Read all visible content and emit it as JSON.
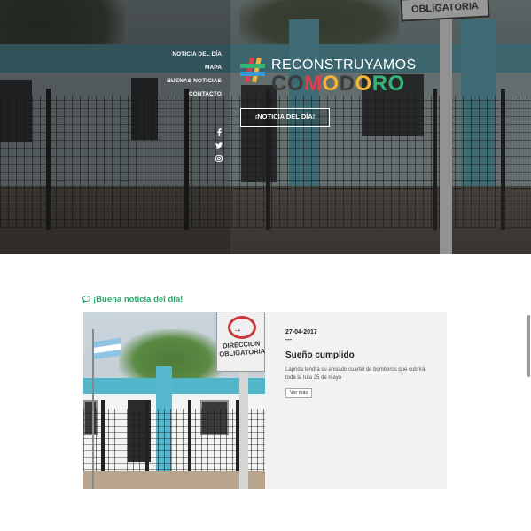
{
  "nav": {
    "items": [
      {
        "label": "NOTICIA DEL DÍA"
      },
      {
        "label": "MAPA"
      },
      {
        "label": "BUENAS NOTICIAS"
      },
      {
        "label": "CONTACTO"
      }
    ]
  },
  "social": {
    "icons": [
      "facebook-icon",
      "twitter-icon",
      "instagram-icon"
    ]
  },
  "logo": {
    "line1": "RECONSTRUYAMOS",
    "line2": "COMODORO",
    "colors": {
      "red": "#e53b4f",
      "yellow": "#f2b634",
      "green": "#35b479",
      "dark": "#3b3b3b"
    }
  },
  "hero": {
    "cta_label": "¡NOTICIA DEL DÍA!",
    "sign_text": "OBLIGATORIA"
  },
  "section": {
    "title": "¡Buena noticia del día!",
    "accent": "#2aa56c"
  },
  "card": {
    "date": "27-04-2017",
    "dash": "—",
    "title": "Sueño cumplido",
    "description": "Laprida tendrá su ansiado cuartel de bomberos que cubrirá toda la ruta 25 de mayo",
    "more_label": "Ver más",
    "sign_text": "DIRECCION OBLIGATORIA"
  }
}
